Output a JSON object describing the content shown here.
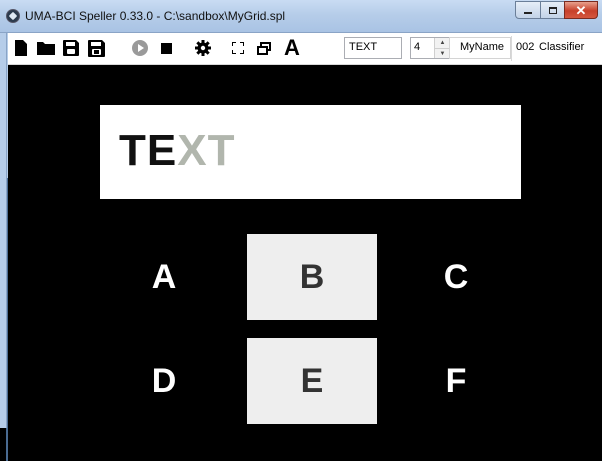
{
  "window": {
    "title": "UMA-BCI Speller 0.33.0 - C:\\sandbox\\MyGrid.spl",
    "controls": {
      "minimize": "–",
      "maximize": "□",
      "close": "✕"
    }
  },
  "toolbar": {
    "icons": [
      "new-file-icon",
      "open-folder-icon",
      "save-icon",
      "save-as-icon",
      "play-icon",
      "stop-icon",
      "gear-icon",
      "fullscreen-icon",
      "restore-window-icon",
      "font-icon"
    ],
    "font_button_label": "A",
    "text_field_value": "TEXT",
    "spinner_value": "4",
    "name_field_value": "MyName",
    "session_number": "002",
    "mode_label": "Classifier"
  },
  "speller": {
    "typed_text": "TE",
    "pending_text": "XT",
    "grid": {
      "rows": [
        [
          {
            "label": "A",
            "highlighted": false
          },
          {
            "label": "B",
            "highlighted": true
          },
          {
            "label": "C",
            "highlighted": false
          }
        ],
        [
          {
            "label": "D",
            "highlighted": false
          },
          {
            "label": "E",
            "highlighted": true
          },
          {
            "label": "F",
            "highlighted": false
          }
        ]
      ]
    }
  },
  "colors": {
    "background": "#000000",
    "highlight": "#eeeeee",
    "cell_text": "#ffffff",
    "highlight_text": "#333333",
    "typed_text": "#111111",
    "pending_text": "#b1b6ad"
  }
}
